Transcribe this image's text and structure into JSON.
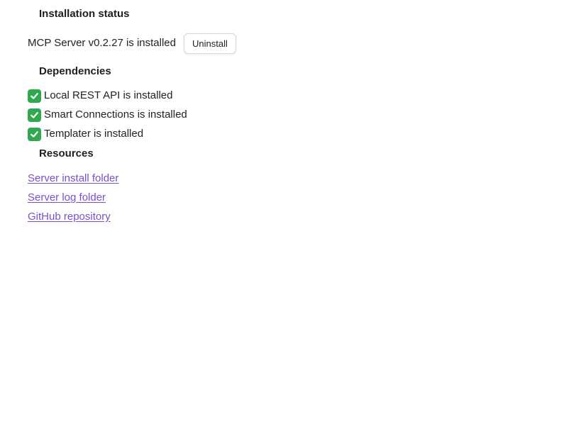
{
  "installation": {
    "heading": "Installation status",
    "status_text": "MCP Server v0.2.27 is installed",
    "uninstall_label": "Uninstall"
  },
  "dependencies": {
    "heading": "Dependencies",
    "items": [
      {
        "icon": "check-mark-icon",
        "label": "Local REST API is installed"
      },
      {
        "icon": "check-mark-icon",
        "label": "Smart Connections is installed"
      },
      {
        "icon": "check-mark-icon",
        "label": "Templater is installed"
      }
    ]
  },
  "resources": {
    "heading": "Resources",
    "links": [
      {
        "label": "Server install folder"
      },
      {
        "label": "Server log folder"
      },
      {
        "label": "GitHub repository"
      }
    ]
  },
  "colors": {
    "check_green": "#2fa84f",
    "link_purple": "#7b4fd0"
  }
}
